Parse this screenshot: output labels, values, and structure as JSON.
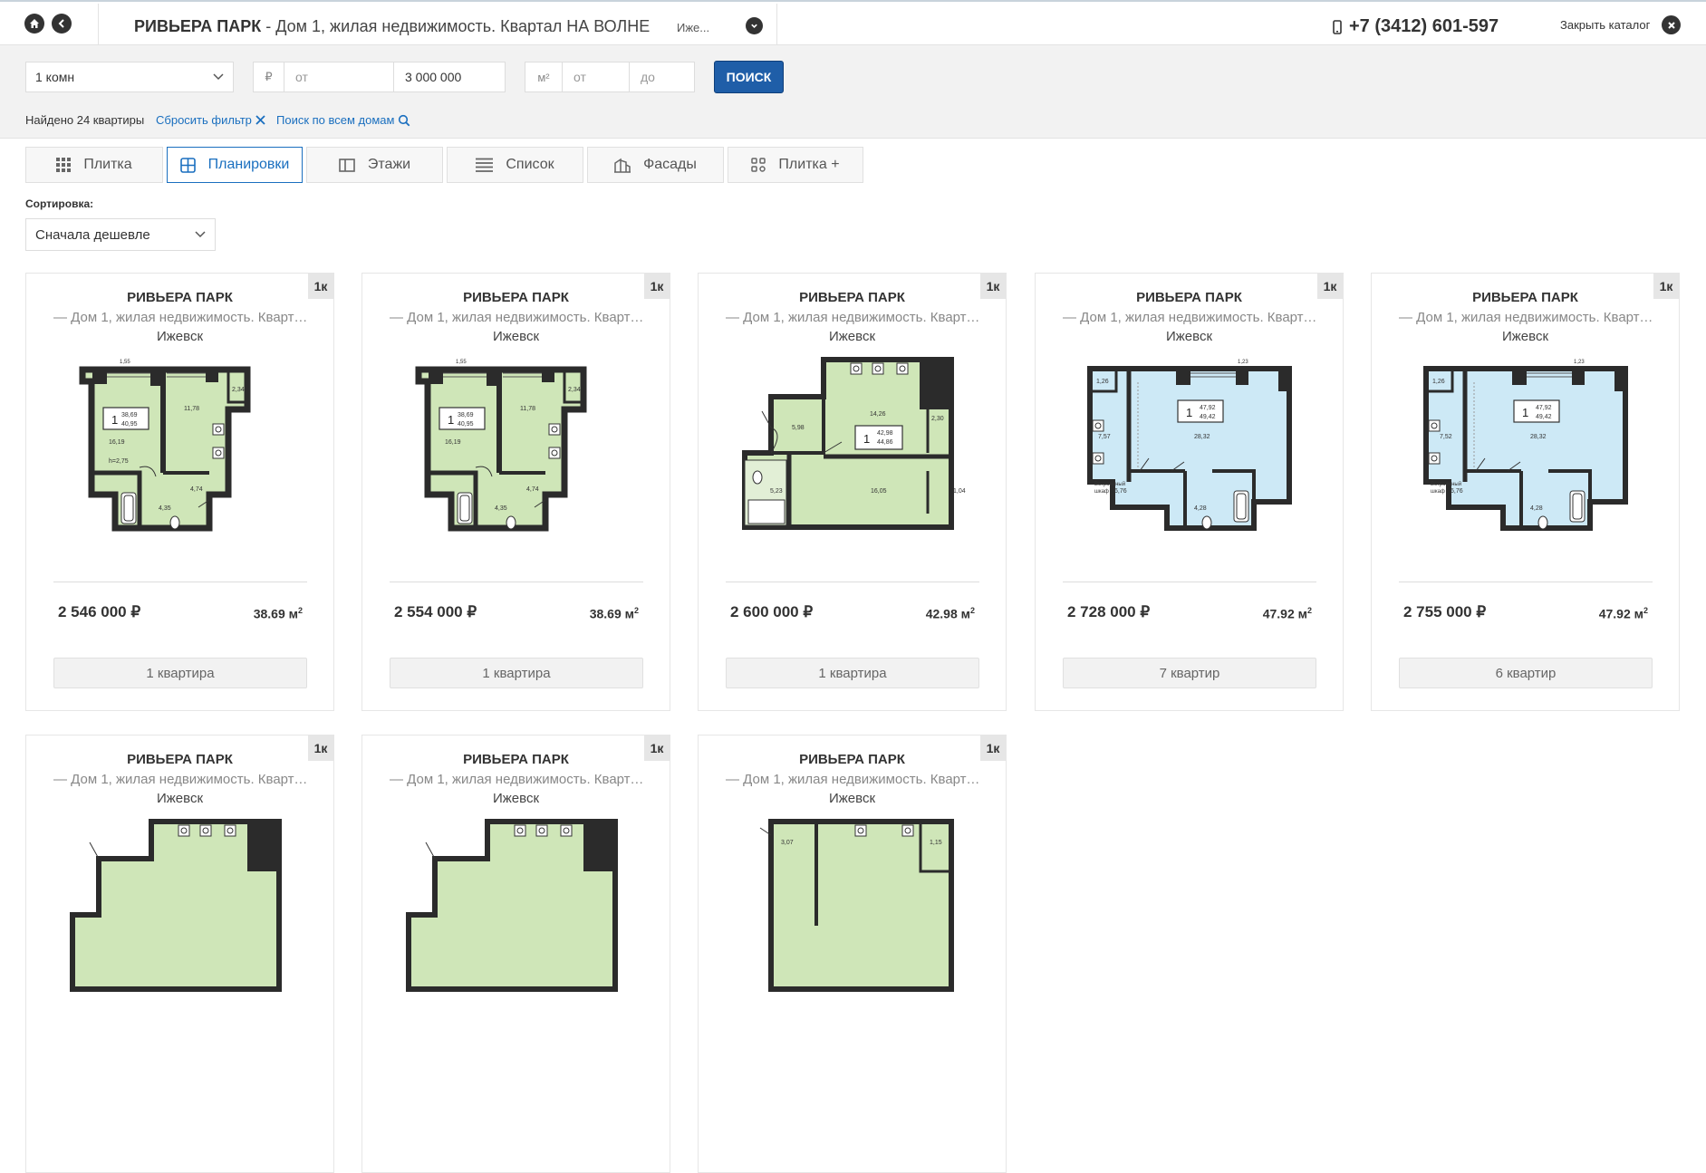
{
  "header": {
    "title_bold": "РИВЬЕРА ПАРК",
    "title_rest": " - Дом 1, жилая недвижимость. Квартал НА ВОЛНЕ",
    "city_short": "Иже...",
    "phone": "+7 (3412) 601-597",
    "close_label": "Закрыть каталог"
  },
  "filter": {
    "rooms_value": "1 комн",
    "currency_symbol": "₽",
    "price_from_placeholder": "от",
    "price_to_value": "3 000 000",
    "area_unit": "м²",
    "area_from_placeholder": "от",
    "area_to_placeholder": "до",
    "search_label": "ПОИСК",
    "found_text": "Найдено 24 квартиры",
    "reset_label": "Сбросить фильтр",
    "search_all_label": "Поиск по всем домам"
  },
  "tabs": [
    {
      "label": "Плитка",
      "icon": "grid-icon"
    },
    {
      "label": "Планировки",
      "icon": "layout-icon"
    },
    {
      "label": "Этажи",
      "icon": "floors-icon"
    },
    {
      "label": "Список",
      "icon": "list-icon"
    },
    {
      "label": "Фасады",
      "icon": "facade-icon"
    },
    {
      "label": "Плитка +",
      "icon": "tiles-plus-icon"
    }
  ],
  "active_tab": "Планировки",
  "sort": {
    "label": "Сортировка:",
    "value": "Сначала дешевле"
  },
  "colors": {
    "accent": "#1f5ea8",
    "plan_green": "#cfe6b8",
    "plan_blue": "#cde9f6",
    "wall": "#2b2b2b"
  },
  "cards": [
    {
      "badge": "1к",
      "title": "РИВЬЕРА ПАРК",
      "subtitle": "— Дом 1, жилая недвижимость. Квартал НА ВОЛНЕ",
      "city": "Ижевск",
      "price": "2 546 000 ₽",
      "area": "38.69 м",
      "count": "1 квартира",
      "plan_color": "green"
    },
    {
      "badge": "1к",
      "title": "РИВЬЕРА ПАРК",
      "subtitle": "— Дом 1, жилая недвижимость. Квартал НА ВОЛНЕ",
      "city": "Ижевск",
      "price": "2 554 000 ₽",
      "area": "38.69 м",
      "count": "1 квартира",
      "plan_color": "green"
    },
    {
      "badge": "1к",
      "title": "РИВЬЕРА ПАРК",
      "subtitle": "— Дом 1, жилая недвижимость. Квартал НА ВОЛНЕ",
      "city": "Ижевск",
      "price": "2 600 000 ₽",
      "area": "42.98 м",
      "count": "1 квартира",
      "plan_color": "green"
    },
    {
      "badge": "1к",
      "title": "РИВЬЕРА ПАРК",
      "subtitle": "— Дом 1, жилая недвижимость. Квартал НА ВОЛНЕ",
      "city": "Ижевск",
      "price": "2 728 000 ₽",
      "area": "47.92 м",
      "count": "7 квартир",
      "plan_color": "blue"
    },
    {
      "badge": "1к",
      "title": "РИВЬЕРА ПАРК",
      "subtitle": "— Дом 1, жилая недвижимость. Квартал НА ВОЛНЕ",
      "city": "Ижевск",
      "price": "2 755 000 ₽",
      "area": "47.92 м",
      "count": "6 квартир",
      "plan_color": "blue"
    },
    {
      "badge": "1к",
      "title": "РИВЬЕРА ПАРК",
      "subtitle": "— Дом 1, жилая недвижимость. Квартал НА ВОЛНЕ",
      "city": "Ижевск"
    },
    {
      "badge": "1к",
      "title": "РИВЬЕРА ПАРК",
      "subtitle": "— Дом 1, жилая недвижимость. Квартал НА ВОЛНЕ",
      "city": "Ижевск"
    },
    {
      "badge": "1к",
      "title": "РИВЬЕРА ПАРК",
      "subtitle": "— Дом 1, жилая недвижимость. Квартал НА ВОЛНЕ",
      "city": "Ижевск"
    }
  ],
  "plans": [
    {
      "room_count": "1",
      "area_living": "38,69",
      "area_total": "40,95",
      "rooms": [
        "16,19",
        "11,78",
        "2,34",
        "4,74",
        "4,35",
        "1,55",
        "h=2,75"
      ]
    },
    {
      "room_count": "1",
      "area_living": "38,69",
      "area_total": "40,95",
      "rooms": [
        "16,19",
        "11,78",
        "2,34",
        "4,74",
        "4,35",
        "1,55"
      ]
    },
    {
      "room_count": "1",
      "area_living": "42,98",
      "area_total": "44,86",
      "rooms": [
        "14,26",
        "5,98",
        "2,30",
        "5,23",
        "16,05",
        "1,04"
      ]
    },
    {
      "room_count": "1",
      "area_living": "47,92",
      "area_total": "49,42",
      "rooms": [
        "28,32",
        "1,26",
        "7,57",
        "6,76",
        "4,28",
        "1,23",
        "Встроенный шкаф"
      ]
    },
    {
      "room_count": "1",
      "area_living": "47,92",
      "area_total": "49,42",
      "rooms": [
        "28,32",
        "1,26",
        "7,52",
        "6,76",
        "4,28",
        "1,23",
        "Встроенный шкаф"
      ]
    },
    {
      "rooms": []
    },
    {
      "rooms": []
    },
    {
      "rooms": [
        "3,07",
        "1,15"
      ]
    }
  ]
}
